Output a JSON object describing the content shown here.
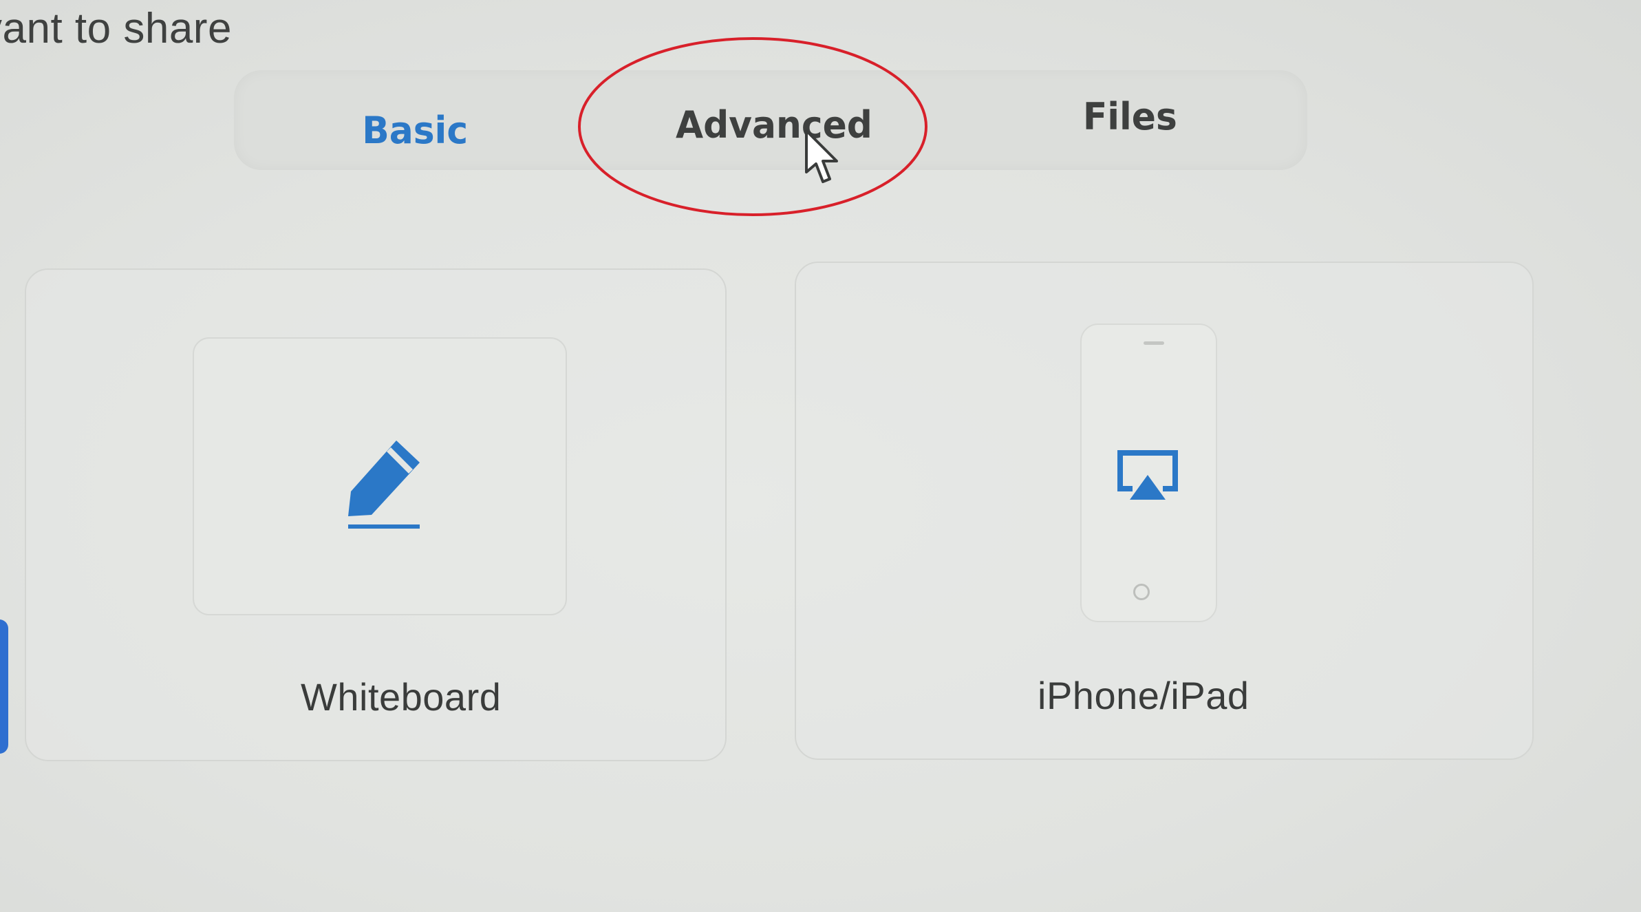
{
  "header": {
    "text": "vant to share"
  },
  "tabs": {
    "items": [
      {
        "label": "Basic",
        "selected": true
      },
      {
        "label": "Advanced",
        "selected": false
      },
      {
        "label": "Files",
        "selected": false
      }
    ]
  },
  "tiles": [
    {
      "label": "Whiteboard",
      "icon": "pencil-icon"
    },
    {
      "label": "iPhone/iPad",
      "icon": "airplay-icon"
    }
  ],
  "annotation": {
    "shape": "ellipse",
    "color": "#d8202a",
    "target": "Advanced"
  },
  "colors": {
    "accent": "#2b78c7",
    "text": "#3e403f",
    "background": "#e2e4e1"
  }
}
